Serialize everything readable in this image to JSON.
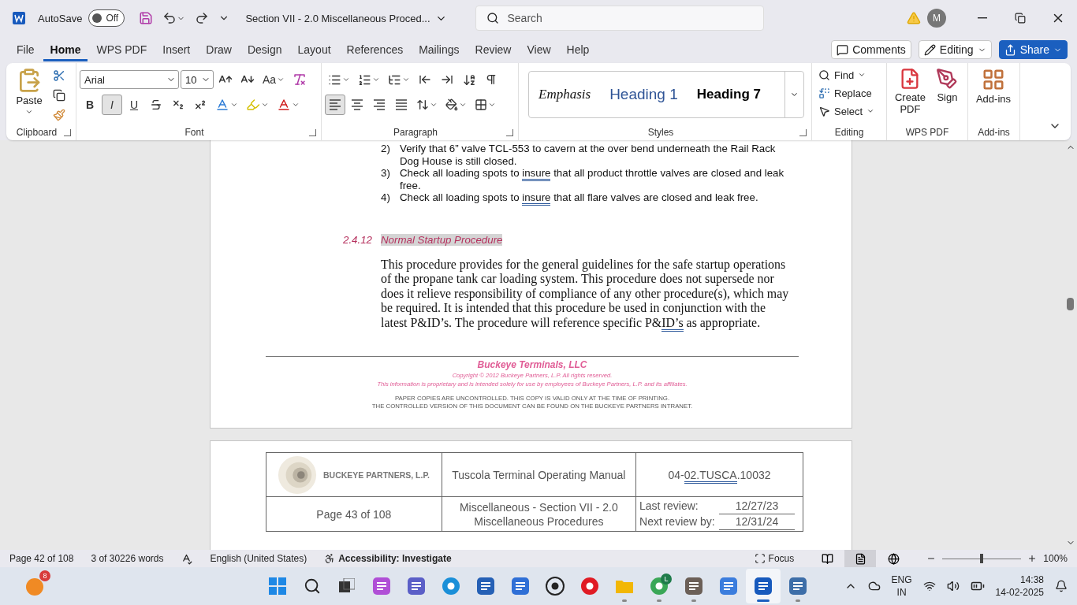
{
  "title_bar": {
    "autosave_label": "AutoSave",
    "autosave": {
      "label": "Off",
      "on": false
    },
    "document_title": "Section VII - 2.0 Miscellaneous Proced...",
    "search_placeholder": "Search",
    "avatar": "M"
  },
  "menu_tabs": [
    {
      "label": "File",
      "selected": false
    },
    {
      "label": "Home",
      "selected": true
    },
    {
      "label": "WPS PDF",
      "selected": false
    },
    {
      "label": "Insert",
      "selected": false
    },
    {
      "label": "Draw",
      "selected": false
    },
    {
      "label": "Design",
      "selected": false
    },
    {
      "label": "Layout",
      "selected": false
    },
    {
      "label": "References",
      "selected": false
    },
    {
      "label": "Mailings",
      "selected": false
    },
    {
      "label": "Review",
      "selected": false
    },
    {
      "label": "View",
      "selected": false
    },
    {
      "label": "Help",
      "selected": false
    }
  ],
  "header_buttons": {
    "comments": "Comments",
    "mode": "Editing",
    "share": "Share"
  },
  "ribbon": {
    "clipboard": {
      "paste": "Paste",
      "label": "Clipboard"
    },
    "font": {
      "name": "Arial",
      "size": "10",
      "change_case": "Aa",
      "label": "Font",
      "formats": [
        {
          "label": "B",
          "kind": "bold",
          "selected": false
        },
        {
          "label": "I",
          "kind": "italic",
          "selected": true
        },
        {
          "label": "U",
          "kind": "underline",
          "selected": false
        }
      ]
    },
    "paragraph": {
      "label": "Paragraph",
      "alignment": [
        {
          "kind": "left",
          "selected": true
        },
        {
          "kind": "center",
          "selected": false
        },
        {
          "kind": "right",
          "selected": false
        },
        {
          "kind": "justify",
          "selected": false
        }
      ]
    },
    "styles": {
      "label": "Styles",
      "items": [
        {
          "label": "Emphasis",
          "kind": "emphasis"
        },
        {
          "label": "Heading 1",
          "kind": "heading1"
        },
        {
          "label": "Heading 7",
          "kind": "heading7"
        }
      ]
    },
    "editing": {
      "label": "Editing",
      "find": "Find",
      "replace": "Replace",
      "select": "Select"
    },
    "wps_pdf": {
      "label": "WPS PDF",
      "create": "Create PDF",
      "sign": "Sign"
    },
    "addins": {
      "label": "Add-ins",
      "button": "Add-ins"
    }
  },
  "document": {
    "list_items": [
      {
        "number": "2)",
        "parts": [
          {
            "text": "Verify that 6” valve TCL-553 to cavern at the over bend underneath the Rail Rack Dog House is still closed.",
            "flagged": false
          }
        ]
      },
      {
        "number": "3)",
        "parts": [
          {
            "text": "Check all loading spots to ",
            "flagged": false
          },
          {
            "text": "insure",
            "flagged": true
          },
          {
            "text": " that all product throttle valves are closed and leak free.",
            "flagged": false
          }
        ]
      },
      {
        "number": "4)",
        "parts": [
          {
            "text": "Check all loading spots to ",
            "flagged": false
          },
          {
            "text": "insure",
            "flagged": true
          },
          {
            "text": " that all flare valves are closed and leak free.",
            "flagged": false
          }
        ]
      }
    ],
    "heading": {
      "number": "2.4.12",
      "title": "Normal Startup Procedure",
      "highlighted": true
    },
    "paragraph": [
      {
        "text": "This procedure provides for the general guidelines for the safe startup operations of the propane tank car loading system. This procedure does not supersede nor does it relieve responsibility of compliance of any other procedure(s), which may be required. It is intended that this procedure be used in conjunction with the latest P&ID’s. The procedure will reference specific P&",
        "flagged": false
      },
      {
        "text": "ID’s",
        "flagged": true
      },
      {
        "text": " as appropriate.",
        "flagged": false
      }
    ],
    "footer": {
      "company": "Buckeye Terminals, LLC",
      "copyright": "Copyright © 2012 Buckeye Partners, L.P. All rights reserved.",
      "notice": "This information is proprietary and is intended solely for use by employees of Buckeye Partners, L.P. and its affiliates.",
      "control_lines": [
        "PAPER COPIES ARE UNCONTROLLED. THIS COPY IS VALID ONLY AT THE TIME OF PRINTING.",
        "THE CONTROLLED VERSION OF THIS DOCUMENT CAN BE FOUND ON THE BUCKEYE PARTNERS INTRANET."
      ]
    },
    "page_header": {
      "logo_text": "BUCKEYE PARTNERS, L.P.",
      "manual_title": "Tuscola Terminal Operating Manual",
      "doc_number": [
        {
          "text": "04-",
          "flagged": false
        },
        {
          "text": "02.TUSCA",
          "flagged": true
        },
        {
          "text": ".10032",
          "flagged": false
        }
      ],
      "page": "Page 43 of 108",
      "section": "Miscellaneous - Section VII - 2.0",
      "section_cont": "Miscellaneous Procedures",
      "last_review_label": "Last review:",
      "last_review": "12/27/23",
      "next_review_label": "Next review by:",
      "next_review": "12/31/24"
    }
  },
  "status_bar": {
    "page": "Page 42 of 108",
    "words": "3 of 30226 words",
    "language": "English (United States)",
    "accessibility": "Accessibility: Investigate",
    "focus": "Focus",
    "views": [
      {
        "kind": "read",
        "selected": false
      },
      {
        "kind": "print",
        "selected": true
      },
      {
        "kind": "web",
        "selected": false
      }
    ],
    "zoom": {
      "level": 0.5,
      "label": "100%"
    }
  },
  "taskbar": {
    "widget_badge": "8",
    "apps": [
      {
        "kind": "start",
        "running": false,
        "active": false
      },
      {
        "kind": "search",
        "running": false,
        "active": false
      },
      {
        "kind": "taskview",
        "running": false,
        "active": false
      },
      {
        "kind": "copilot",
        "running": false,
        "active": false
      },
      {
        "kind": "teams",
        "running": false,
        "active": false
      },
      {
        "kind": "edge",
        "running": false,
        "active": false
      },
      {
        "kind": "store",
        "running": false,
        "active": false
      },
      {
        "kind": "automate",
        "running": false,
        "active": false
      },
      {
        "kind": "dell",
        "running": false,
        "active": false
      },
      {
        "kind": "opera",
        "running": false,
        "active": false
      },
      {
        "kind": "folder",
        "running": true,
        "active": false
      },
      {
        "kind": "chrome",
        "running": true,
        "active": false,
        "badge": "L"
      },
      {
        "kind": "viewer",
        "running": true,
        "active": false
      },
      {
        "kind": "cloud",
        "running": false,
        "active": false
      },
      {
        "kind": "word",
        "running": true,
        "active": true
      },
      {
        "kind": "remote",
        "running": true,
        "active": false
      }
    ],
    "language": "ENG",
    "region": "IN",
    "time": "14:38",
    "date": "14-02-2025"
  }
}
